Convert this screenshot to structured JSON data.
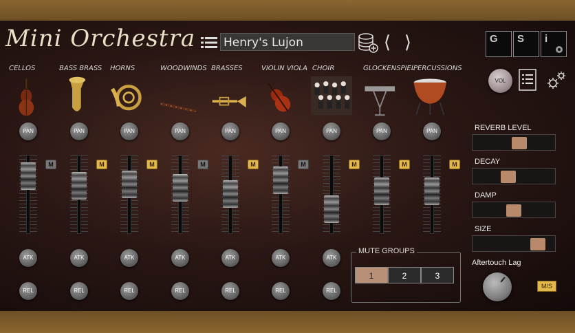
{
  "app": {
    "title": "Mini Orchestra"
  },
  "header": {
    "preset_name": "Henry's Lujon",
    "gsi_buttons": [
      "G",
      "S",
      "i"
    ]
  },
  "instruments": [
    {
      "label": "CELLOS",
      "pan": "PAN",
      "atk": "ATK",
      "rel": "REL",
      "mute": "M",
      "muted": false,
      "fader_level": 0.86,
      "icon": "cello-icon"
    },
    {
      "label": "BASS BRASS",
      "pan": "PAN",
      "atk": "ATK",
      "rel": "REL",
      "mute": "M",
      "muted": true,
      "fader_level": 0.66,
      "icon": "tuba-icon"
    },
    {
      "label": "HORNS",
      "pan": "PAN",
      "atk": "ATK",
      "rel": "REL",
      "mute": "M",
      "muted": true,
      "fader_level": 0.7,
      "icon": "french-horn-icon"
    },
    {
      "label": "WOODWINDS",
      "pan": "PAN",
      "atk": "ATK",
      "rel": "REL",
      "mute": "M",
      "muted": false,
      "fader_level": 0.62,
      "icon": "bassoon-icon"
    },
    {
      "label": "BRASSES",
      "pan": "PAN",
      "atk": "ATK",
      "rel": "REL",
      "mute": "M",
      "muted": true,
      "fader_level": 0.5,
      "icon": "trumpet-icon"
    },
    {
      "label": "VIOLIN VIOLA",
      "pan": "PAN",
      "atk": "ATK",
      "rel": "REL",
      "mute": "M",
      "muted": false,
      "fader_level": 0.78,
      "icon": "violin-icon"
    },
    {
      "label": "CHOIR",
      "pan": "PAN",
      "atk": "ATK",
      "rel": "REL",
      "mute": "M",
      "muted": true,
      "fader_level": 0.2,
      "icon": "choir-icon"
    },
    {
      "label": "GLOCKENSPIEL",
      "pan": "PAN",
      "atk": null,
      "rel": null,
      "mute": "M",
      "muted": true,
      "fader_level": 0.56,
      "icon": "glockenspiel-icon"
    },
    {
      "label": "PERCUSSIONS",
      "pan": "PAN",
      "atk": null,
      "rel": null,
      "mute": "M",
      "muted": true,
      "fader_level": 0.55,
      "icon": "timpani-icon"
    }
  ],
  "effects": {
    "vol_label": "VOL",
    "reverb": {
      "label": "REVERB LEVEL",
      "value": 0.58
    },
    "decay": {
      "label": "DECAY",
      "value": 0.42
    },
    "damp": {
      "label": "DAMP",
      "value": 0.5
    },
    "size": {
      "label": "SIZE",
      "value": 0.86
    }
  },
  "mute_groups": {
    "title": "MUTE GROUPS",
    "buttons": [
      "1",
      "2",
      "3"
    ],
    "active": 0
  },
  "aftertouch": {
    "label": "Aftertouch Lag",
    "ms_label": "M/S"
  },
  "colors": {
    "accent": "#e2b84a",
    "mute_off": "#777777",
    "slider_handle": "#b88a6a"
  }
}
